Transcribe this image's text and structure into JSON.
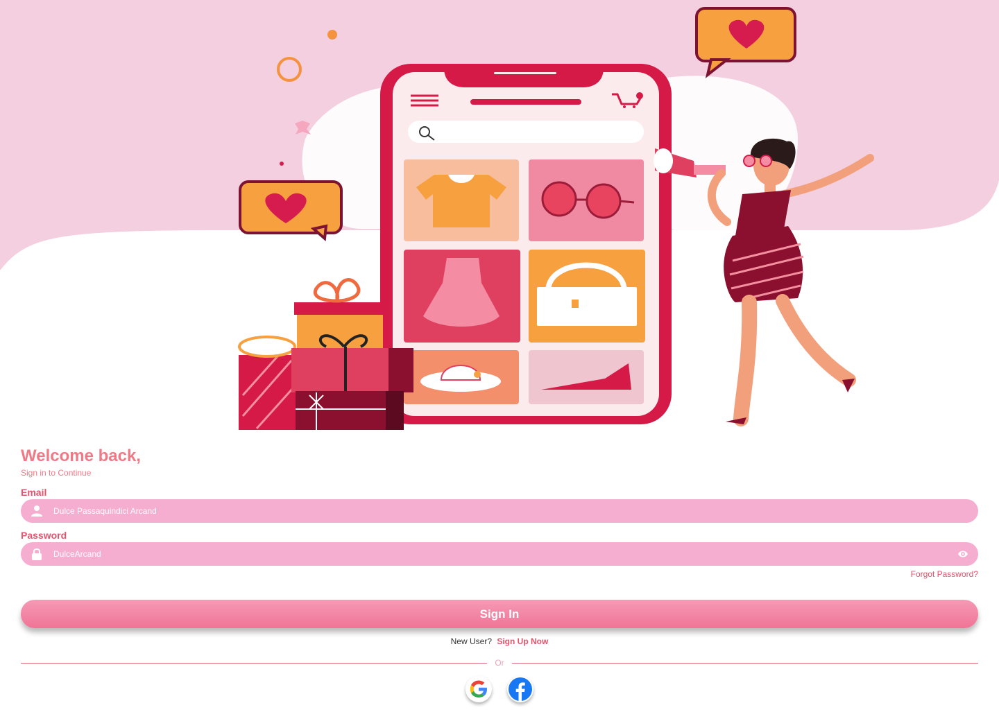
{
  "colors": {
    "accent": "#e2536c",
    "title": "#ef7a86",
    "field_bg": "#f5aed0",
    "button": "#f07496",
    "hero_bg": "#f3cfe0"
  },
  "login": {
    "title": "Welcome back,",
    "subtitle": "Sign in to Continue",
    "email_label": "Email",
    "email_value": "Dulce Passaquindici Arcand",
    "password_label": "Password",
    "password_value": "DulceArcand",
    "forgot": "Forgot Password?",
    "signin": "Sign In",
    "new_user": "New User?",
    "signup": "Sign Up Now",
    "or": "Or"
  },
  "icons": {
    "email": "user-icon",
    "password": "lock-icon",
    "toggle_visibility": "eye-icon",
    "google": "google-icon",
    "facebook": "facebook-icon"
  }
}
